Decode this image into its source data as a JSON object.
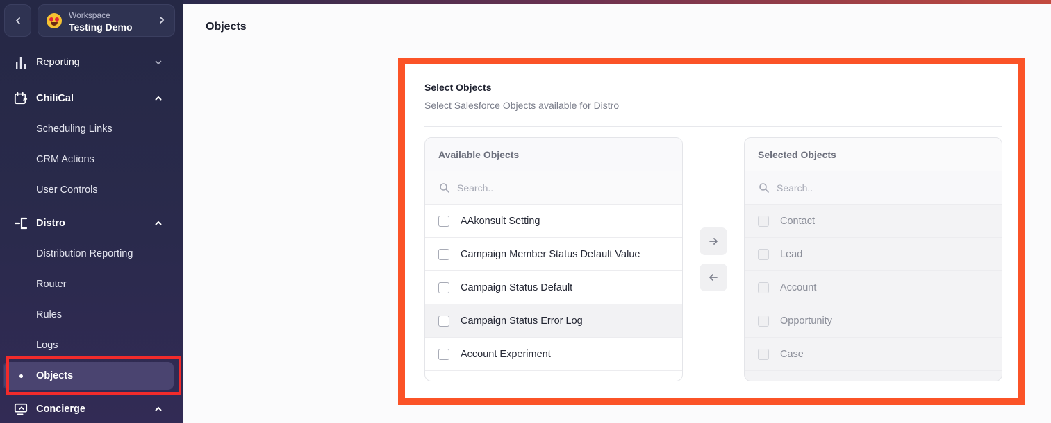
{
  "workspace": {
    "caption": "Workspace",
    "name": "Testing Demo"
  },
  "nav": {
    "reporting": "Reporting",
    "chilical": "ChiliCal",
    "scheduling_links": "Scheduling Links",
    "crm_actions": "CRM Actions",
    "user_controls": "User Controls",
    "distro": "Distro",
    "distribution_reporting": "Distribution Reporting",
    "router": "Router",
    "rules": "Rules",
    "logs": "Logs",
    "objects": "Objects",
    "concierge": "Concierge"
  },
  "page": {
    "title": "Objects"
  },
  "card": {
    "title": "Select Objects",
    "subtitle": "Select Salesforce Objects available for Distro"
  },
  "available": {
    "header": "Available Objects",
    "search_placeholder": "Search..",
    "items": [
      "AAkonsult Setting",
      "Campaign Member Status Default Value",
      "Campaign Status Default",
      "Campaign Status Error Log",
      "Account Experiment"
    ]
  },
  "selected": {
    "header": "Selected Objects",
    "search_placeholder": "Search..",
    "items": [
      "Contact",
      "Lead",
      "Account",
      "Opportunity",
      "Case"
    ]
  },
  "colors": {
    "highlight_outer": "#fb5327",
    "highlight_nav": "#f22b2b",
    "sidebar_bg": "#252845"
  }
}
